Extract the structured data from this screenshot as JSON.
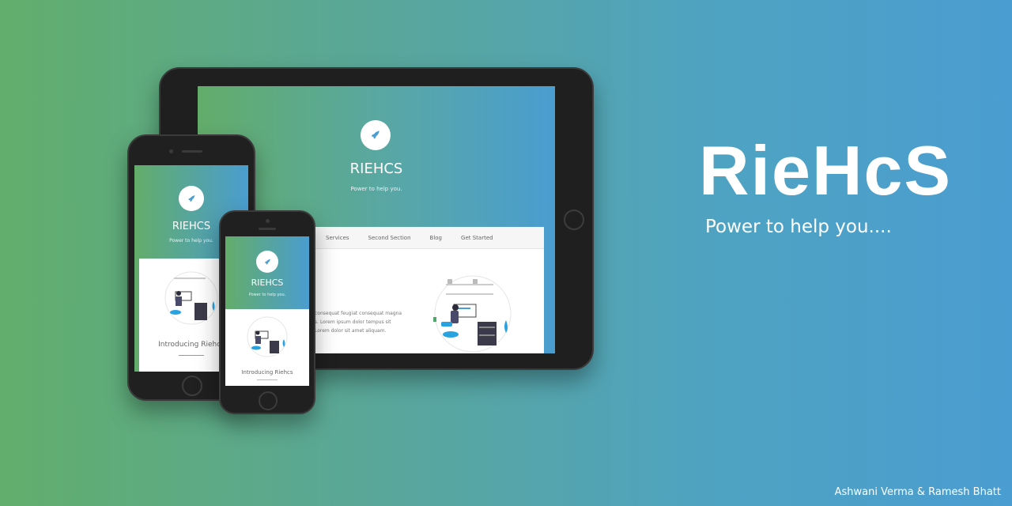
{
  "brand": {
    "title": "RieHcS",
    "tagline": "Power to help you....",
    "credits": "Ashwani Verma & Ramesh Bhatt"
  },
  "mockup_site": {
    "title": "RIEHCS",
    "tagline": "Power to help you.",
    "nav": [
      "Services",
      "Second Section",
      "Blog",
      "Get Started"
    ],
    "body_lines": [
      "consequat feugiat consequat magna",
      "s. Lorem ipsum dolor tempus sit",
      "Lorem dolor sit amet aliquam."
    ],
    "intro_heading": "Introducing Riehcs"
  },
  "icons": {
    "logo": "rocket-icon"
  },
  "colors": {
    "accent": "#4a9dd0",
    "green": "#62ae6c"
  }
}
